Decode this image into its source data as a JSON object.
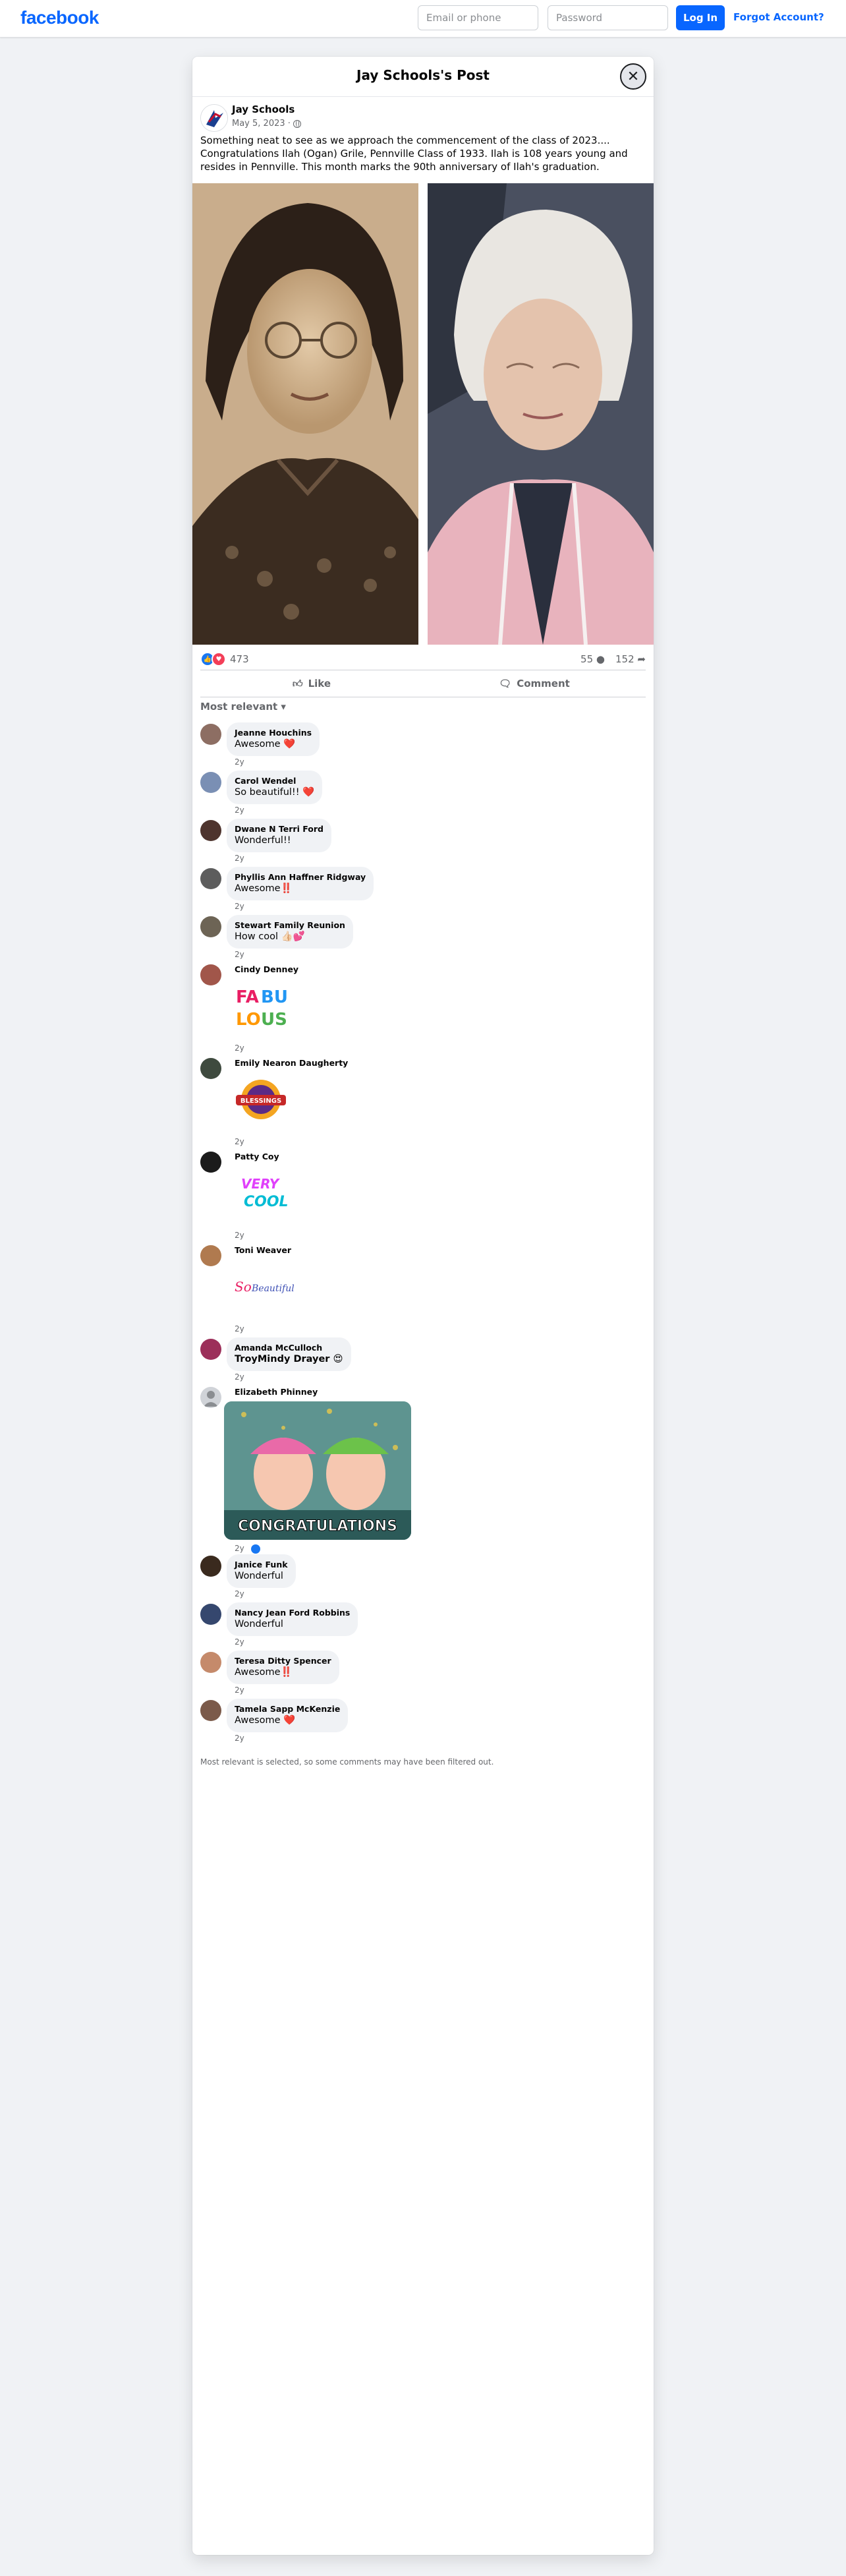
{
  "topbar": {
    "logo": "facebook",
    "email_placeholder": "Email or phone",
    "password_placeholder": "Password",
    "login_label": "Log In",
    "forgot_label": "Forgot Account?"
  },
  "post": {
    "title": "Jay Schools's Post",
    "author": "Jay Schools",
    "date": "May 5, 2023 ·",
    "text": "Something neat to see as we approach the commencement of the class of 2023.... Congratulations Ilah (Ogan) Grile, Pennville Class of 1933. Ilah is 108 years young and resides in Pennville. This month marks the 90th anniversary of Ilah's graduation.",
    "reaction_count": "473",
    "comment_count": "55",
    "share_count": "152",
    "like_label": "Like",
    "comment_label": "Comment",
    "filter_label": "Most relevant",
    "footnote": "Most relevant is selected, so some comments may have been filtered out."
  },
  "comments": [
    {
      "name": "Jeanne Houchins",
      "text": "Awesome ❤️",
      "time": "2y"
    },
    {
      "name": "Carol Wendel",
      "text": "So beautiful!! ❤️",
      "time": "2y"
    },
    {
      "name": "Dwane N Terri Ford",
      "text": "Wonderful!!",
      "time": "2y"
    },
    {
      "name": "Phyllis Ann Haffner Ridgway",
      "text": "Awesome‼️",
      "time": "2y"
    },
    {
      "name": "Stewart Family Reunion",
      "text": "How cool 👍🏻💕",
      "time": "2y"
    },
    {
      "name": "Cindy Denney",
      "sticker": "FABU LOUS",
      "time": "2y"
    },
    {
      "name": "Emily Nearon Daugherty",
      "sticker": "BLESSINGS",
      "time": "2y"
    },
    {
      "name": "Patty Coy",
      "sticker": "VERY COOL",
      "time": "2y"
    },
    {
      "name": "Toni Weaver",
      "sticker": "So Beautiful",
      "time": "2y"
    },
    {
      "name": "Amanda McCulloch",
      "text": "TroyMindy Drayer 😍",
      "time": "2y"
    },
    {
      "name": "Elizabeth Phinney",
      "image_caption": "CONGRATULATIONS",
      "time": "2y"
    },
    {
      "name": "Janice Funk",
      "text": "Wonderful",
      "time": "2y"
    },
    {
      "name": "Nancy Jean Ford Robbins",
      "text": "Wonderful",
      "time": "2y"
    },
    {
      "name": "Teresa Ditty Spencer",
      "text": "Awesome‼️",
      "time": "2y"
    },
    {
      "name": "Tamela Sapp McKenzie",
      "text": "Awesome ❤️",
      "time": "2y"
    }
  ],
  "colors": {
    "brand": "#0866ff",
    "background": "#f0f2f5",
    "bubble": "#f0f2f5",
    "love": "#f33e58",
    "like": "#1877f2"
  },
  "icons": [
    "close-icon",
    "globe-icon",
    "like-reaction-icon",
    "love-reaction-icon",
    "comment-icon",
    "share-icon",
    "thumbs-up-icon",
    "chevron-down-icon"
  ]
}
